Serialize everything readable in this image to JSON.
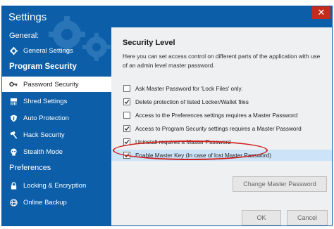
{
  "window": {
    "title": "Settings",
    "close_symbol": "✕"
  },
  "sidebar": {
    "general_header": "General:",
    "general_item": {
      "label": "General Settings",
      "icon": "gear-icon"
    },
    "program_security_header": "Program Security",
    "items": [
      {
        "label": "Password Security",
        "icon": "key-icon",
        "selected": true
      },
      {
        "label": "Shred Settings",
        "icon": "shred-icon",
        "selected": false
      },
      {
        "label": "Auto Protection",
        "icon": "shield-icon",
        "selected": false
      },
      {
        "label": "Hack Security",
        "icon": "hammer-icon",
        "selected": false
      },
      {
        "label": "Stealth Mode",
        "icon": "stealth-icon",
        "selected": false
      }
    ],
    "preferences_header": "Preferences",
    "pref_items": [
      {
        "label": "Locking & Encryption",
        "icon": "lock-icon"
      },
      {
        "label": "Online Backup",
        "icon": "globe-icon"
      }
    ]
  },
  "panel": {
    "title": "Security Level",
    "description": "Here you can set access control on different parts of the application with use of an admin level master password.",
    "options": [
      {
        "label": "Ask Master Password for 'Lock Files' only.",
        "checked": false
      },
      {
        "label": "Delete protection of listed Locker/Wallet files",
        "checked": true
      },
      {
        "label": "Access to the Preferences settings requires a Master Password",
        "checked": false
      },
      {
        "label": "Access to Program Security settings requires a Master Password",
        "checked": true
      },
      {
        "label": "Uninstall requires a Master Password",
        "checked": true
      },
      {
        "label": "Enable Master Key (In case of lost Master Password)",
        "checked": true,
        "highlighted": true
      }
    ],
    "change_button": "Change Master Password",
    "ok_button": "OK",
    "cancel_button": "Cancel"
  },
  "colors": {
    "sidebar_bg": "#0c5ea8",
    "highlight": "#cde3f7",
    "annotation": "#d02020",
    "close": "#c42b1c"
  }
}
